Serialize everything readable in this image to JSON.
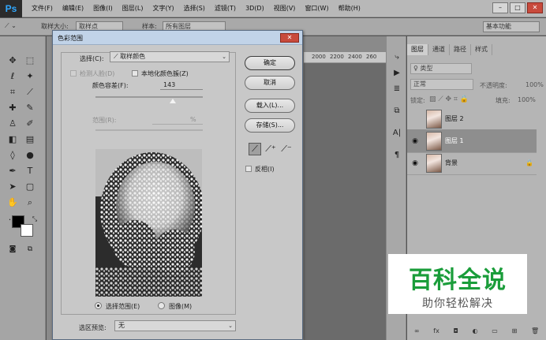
{
  "app": {
    "logo": "Ps",
    "menu": [
      "文件(F)",
      "编辑(E)",
      "图像(I)",
      "图层(L)",
      "文字(Y)",
      "选择(S)",
      "滤镜(T)",
      "3D(D)",
      "视图(V)",
      "窗口(W)",
      "帮助(H)"
    ],
    "window_buttons": [
      "–",
      "□",
      "✕"
    ]
  },
  "options_bar": {
    "sample_size_label": "取样大小:",
    "sample_size_value": "取样点",
    "sample_label": "样本:",
    "sample_value": "所有图层",
    "workspace": "基本功能"
  },
  "ruler": {
    "marks": [
      "2000",
      "2200",
      "2400",
      "260"
    ]
  },
  "layers_panel": {
    "tabs": [
      "图层",
      "通道",
      "路径",
      "样式"
    ],
    "filter_kind": "♀ 类型",
    "blend_mode": "正常",
    "opacity_label": "不透明度:",
    "opacity_value": "100%",
    "lock_label": "锁定:",
    "fill_label": "填充:",
    "fill_value": "100%",
    "layers": [
      {
        "name": "图层 2",
        "visible": false,
        "locked": false,
        "selected": false
      },
      {
        "name": "图层 1",
        "visible": true,
        "locked": false,
        "selected": true
      },
      {
        "name": "背景",
        "visible": true,
        "locked": true,
        "selected": false
      }
    ]
  },
  "watermark": {
    "title": "百科全说",
    "subtitle": "助你轻松解决"
  },
  "dialog": {
    "title": "色彩范围",
    "select_label": "选择(C):",
    "select_value": "取样颜色",
    "detect_faces_label": "检测人脸(D)",
    "localized_label": "本地化颜色簇(Z)",
    "fuzziness_label": "颜色容差(F):",
    "fuzziness_value": "143",
    "fuzziness_fraction": 0.72,
    "range_label": "范围(R):",
    "range_unit": "%",
    "buttons": {
      "ok": "确定",
      "cancel": "取消",
      "load": "载入(L)...",
      "save": "存储(S)..."
    },
    "invert_label": "反相(I)",
    "radio_selection": "选择范围(E)",
    "radio_image": "图像(M)",
    "preview_label": "选区预览:",
    "preview_value": "无"
  }
}
